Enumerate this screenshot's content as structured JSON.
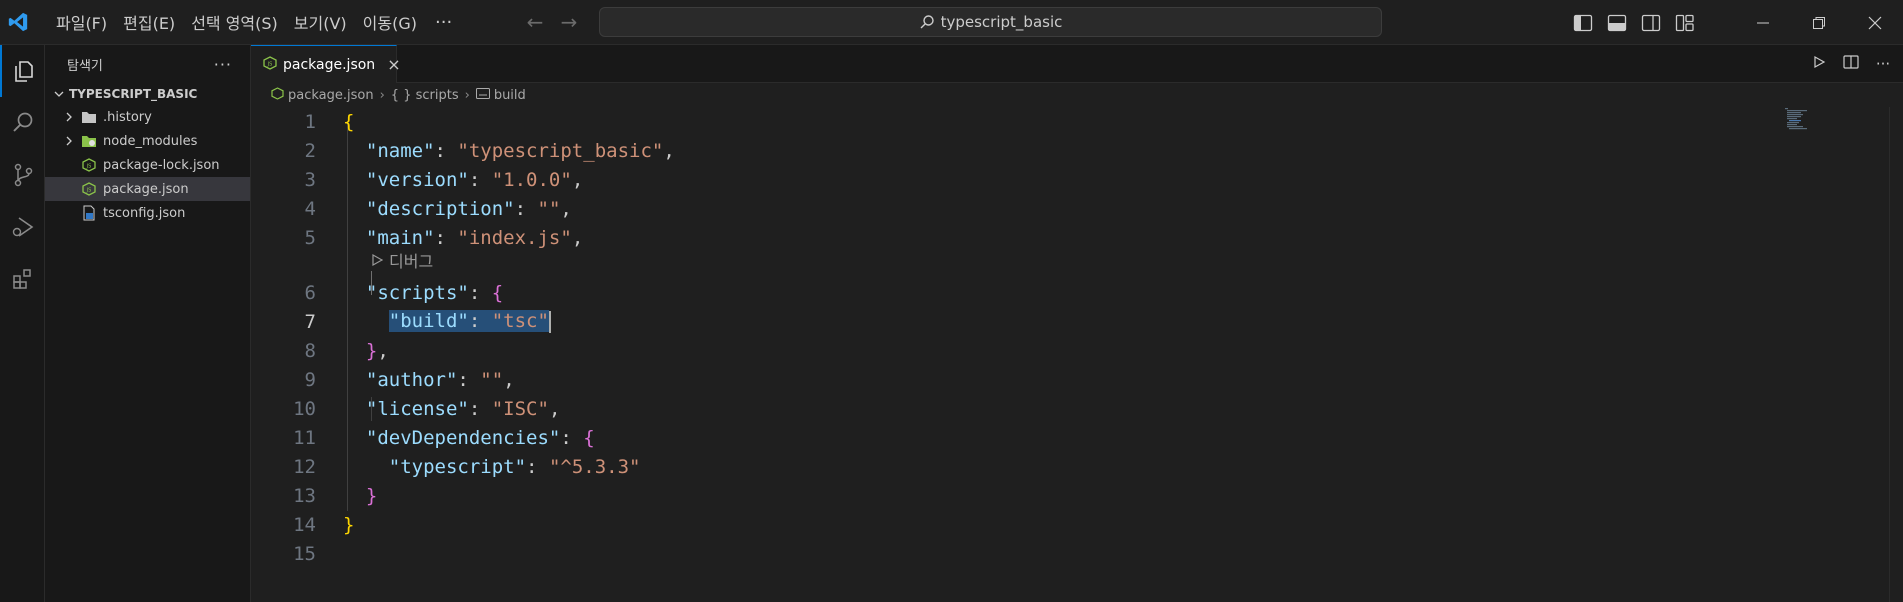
{
  "menu": {
    "items": [
      "파일(F)",
      "편집(E)",
      "선택 영역(S)",
      "보기(V)",
      "이동(G)"
    ],
    "more": "···"
  },
  "command_center": {
    "text": "typescript_basic"
  },
  "sidebar": {
    "title": "탐색기",
    "more": "···",
    "root": "TYPESCRIPT_BASIC",
    "items": [
      {
        "label": ".history",
        "type": "folder",
        "icon": "folder-icon"
      },
      {
        "label": "node_modules",
        "type": "folder",
        "icon": "node-folder-icon"
      },
      {
        "label": "package-lock.json",
        "type": "file",
        "icon": "json-file-icon"
      },
      {
        "label": "package.json",
        "type": "file",
        "icon": "json-file-icon",
        "selected": true
      },
      {
        "label": "tsconfig.json",
        "type": "file",
        "icon": "ts-config-icon"
      }
    ]
  },
  "tab": {
    "label": "package.json",
    "close": "×"
  },
  "breadcrumb": {
    "file": "package.json",
    "obj": "{ } scripts",
    "prop": "build"
  },
  "codelens": {
    "label": "디버그"
  },
  "editor": {
    "active_line": 7,
    "line_numbers": [
      "1",
      "2",
      "3",
      "4",
      "5",
      "6",
      "7",
      "8",
      "9",
      "10",
      "11",
      "12",
      "13",
      "14",
      "15"
    ]
  },
  "code": {
    "l2k": "\"name\"",
    "l2v": "\"typescript_basic\"",
    "l3k": "\"version\"",
    "l3v": "\"1.0.0\"",
    "l4k": "\"description\"",
    "l4v": "\"\"",
    "l5k": "\"main\"",
    "l5v": "\"index.js\"",
    "l6k": "\"scripts\"",
    "l7k": "\"build\"",
    "l7v": "\"tsc\"",
    "l9k": "\"author\"",
    "l9v": "\"\"",
    "l10k": "\"license\"",
    "l10v": "\"ISC\"",
    "l11k": "\"devDependencies\"",
    "l12k": "\"typescript\"",
    "l12v": "\"^5.3.3\""
  },
  "colors": {
    "accent": "#0078d4",
    "key": "#9cdcfe",
    "string": "#ce9178",
    "bracket_gold": "#ffd700",
    "bracket_orchid": "#da70d6",
    "selection": "#264f78"
  }
}
